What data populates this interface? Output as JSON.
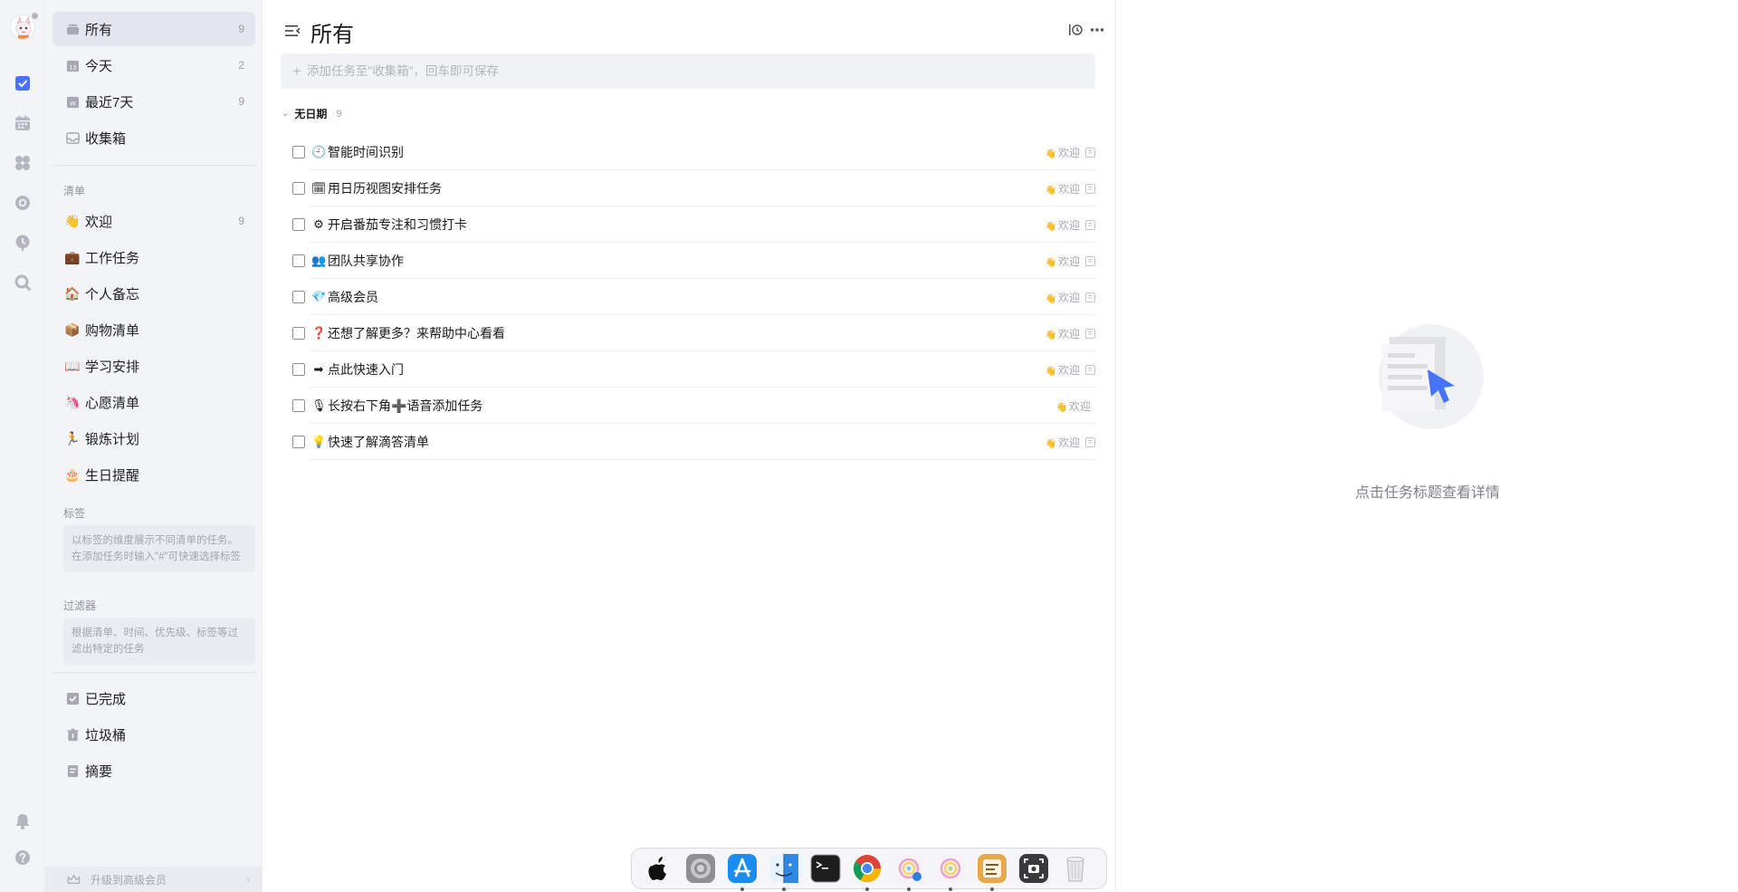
{
  "sidebar": {
    "smart_lists": [
      {
        "label": "所有",
        "count": "9",
        "icon": "all-lists-icon"
      },
      {
        "label": "今天",
        "count": "2",
        "icon": "calendar-today-icon"
      },
      {
        "label": "最近7天",
        "count": "9",
        "icon": "calendar-week-icon"
      },
      {
        "label": "收集箱",
        "count": "",
        "icon": "inbox-icon"
      }
    ],
    "lists_title": "清单",
    "lists": [
      {
        "emoji": "👋",
        "label": "欢迎",
        "count": "9"
      },
      {
        "emoji": "💼",
        "label": "工作任务",
        "count": ""
      },
      {
        "emoji": "🏠",
        "label": "个人备忘",
        "count": ""
      },
      {
        "emoji": "📦",
        "label": "购物清单",
        "count": ""
      },
      {
        "emoji": "📖",
        "label": "学习安排",
        "count": ""
      },
      {
        "emoji": "🦄",
        "label": "心愿清单",
        "count": ""
      },
      {
        "emoji": "🏃",
        "label": "锻炼计划",
        "count": ""
      },
      {
        "emoji": "🎂",
        "label": "生日提醒",
        "count": ""
      }
    ],
    "tags_title": "标签",
    "tags_hint": "以标签的维度展示不同清单的任务。在添加任务时输入\"#\"可快速选择标签",
    "filters_title": "过滤器",
    "filters_hint": "根据清单、时间、优先级、标签等过滤出特定的任务",
    "system_lists": [
      {
        "label": "已完成",
        "icon": "completed-icon"
      },
      {
        "label": "垃圾桶",
        "icon": "trash-icon"
      },
      {
        "label": "摘要",
        "icon": "summary-icon"
      }
    ],
    "upgrade_label": "升级到高级会员",
    "upgrade_chevron": "›"
  },
  "main": {
    "title": "所有",
    "add_placeholder": "添加任务至\"收集箱\"，回车即可保存",
    "add_plus": "+",
    "group": {
      "chevron": "⌄",
      "label": "无日期",
      "count": "9"
    },
    "tasks": [
      {
        "emoji": "🕘",
        "title": "智能时间识别",
        "tag_emoji": "👋",
        "tag": "欢迎",
        "has_note": true
      },
      {
        "emoji": "🗓",
        "title": "用日历视图安排任务",
        "tag_emoji": "👋",
        "tag": "欢迎",
        "has_note": true
      },
      {
        "emoji": "⚙",
        "title": "开启番茄专注和习惯打卡",
        "tag_emoji": "👋",
        "tag": "欢迎",
        "has_note": true
      },
      {
        "emoji": "👥",
        "title": "团队共享协作",
        "tag_emoji": "👋",
        "tag": "欢迎",
        "has_note": true
      },
      {
        "emoji": "💎",
        "title": "高级会员",
        "tag_emoji": "👋",
        "tag": "欢迎",
        "has_note": true
      },
      {
        "emoji": "❓",
        "title": "还想了解更多？来帮助中心看看",
        "tag_emoji": "👋",
        "tag": "欢迎",
        "has_note": true
      },
      {
        "emoji": "➡",
        "title": "点此快速入门",
        "tag_emoji": "👋",
        "tag": "欢迎",
        "has_note": true
      },
      {
        "emoji": "🎙",
        "title": "长按右下角➕语音添加任务",
        "tag_emoji": "👋",
        "tag": "欢迎",
        "has_note": false
      },
      {
        "emoji": "💡",
        "title": "快速了解滴答清单",
        "tag_emoji": "👋",
        "tag": "欢迎",
        "has_note": true
      }
    ]
  },
  "detail": {
    "empty_text": "点击任务标题查看详情"
  },
  "rail": {
    "icons": [
      "tasks-icon",
      "calendar-icon",
      "matrix-icon",
      "pomodoro-icon",
      "habit-icon",
      "search-icon",
      "notification-bell-icon",
      "help-icon"
    ]
  },
  "dock": {
    "apps": [
      "apple-icon",
      "system-settings-icon",
      "app-store-icon",
      "finder-icon",
      "terminal-icon",
      "chrome-icon",
      "app-icon-a",
      "app-icon-b",
      "ticktick-icon",
      "screenshot-icon",
      "trash-icon"
    ]
  },
  "colors": {
    "accent": "#4772fa",
    "sidebar_bg": "#f3f4f8",
    "selected_bg": "#e3e6ef"
  }
}
